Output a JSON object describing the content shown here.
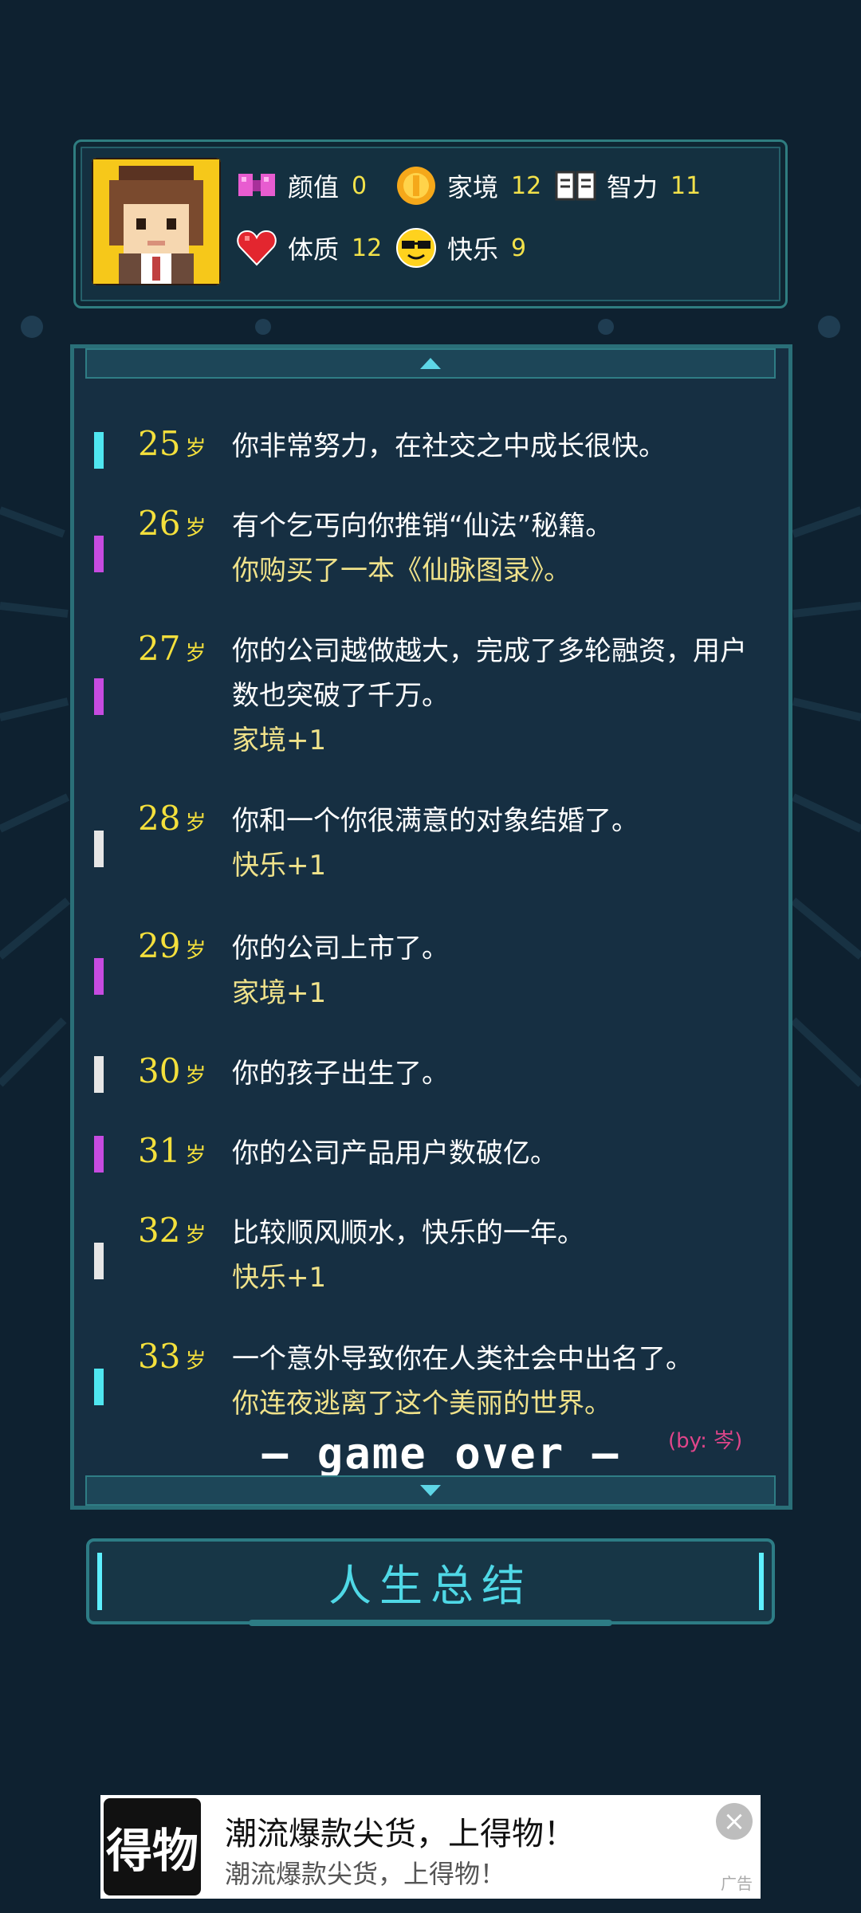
{
  "stats": {
    "appearance": {
      "label": "颜值",
      "value": "0"
    },
    "family": {
      "label": "家境",
      "value": "12"
    },
    "intelligence": {
      "label": "智力",
      "value": "11"
    },
    "constitution": {
      "label": "体质",
      "value": "12"
    },
    "happiness": {
      "label": "快乐",
      "value": "9"
    }
  },
  "log": {
    "age_unit": "岁",
    "entries": [
      {
        "age": "25",
        "text": "你非常努力，在社交之中成长很快。",
        "sub": "",
        "marker_color": "#4fe6f0"
      },
      {
        "age": "26",
        "text": "有个乞丐向你推销“仙法”秘籍。",
        "sub": "你购买了一本《仙脉图录》。",
        "marker_color": "#c64be0"
      },
      {
        "age": "27",
        "text": "你的公司越做越大，完成了多轮融资，用户数也突破了千万。",
        "sub": "家境+1",
        "marker_color": "#c64be0"
      },
      {
        "age": "28",
        "text": "你和一个你很满意的对象结婚了。",
        "sub": "快乐+1",
        "marker_color": "#e6e6e6"
      },
      {
        "age": "29",
        "text": "你的公司上市了。",
        "sub": "家境+1",
        "marker_color": "#c64be0"
      },
      {
        "age": "30",
        "text": "你的孩子出生了。",
        "sub": "",
        "marker_color": "#e6e6e6"
      },
      {
        "age": "31",
        "text": "你的公司产品用户数破亿。",
        "sub": "",
        "marker_color": "#c64be0"
      },
      {
        "age": "32",
        "text": "比较顺风顺水，快乐的一年。",
        "sub": "快乐+1",
        "marker_color": "#e6e6e6"
      },
      {
        "age": "33",
        "text": "一个意外导致你在人类社会中出名了。",
        "sub": "你连夜逃离了这个美丽的世界。",
        "marker_color": "#4fe6f0"
      }
    ],
    "game_over": "— game over —",
    "byline": "(by: 岑)"
  },
  "summary_button": "人生总结",
  "ad": {
    "logo": "得物",
    "title": "潮流爆款尖货，上得物！",
    "subtitle": "潮流爆款尖货，上得物！",
    "tag": "广告"
  }
}
